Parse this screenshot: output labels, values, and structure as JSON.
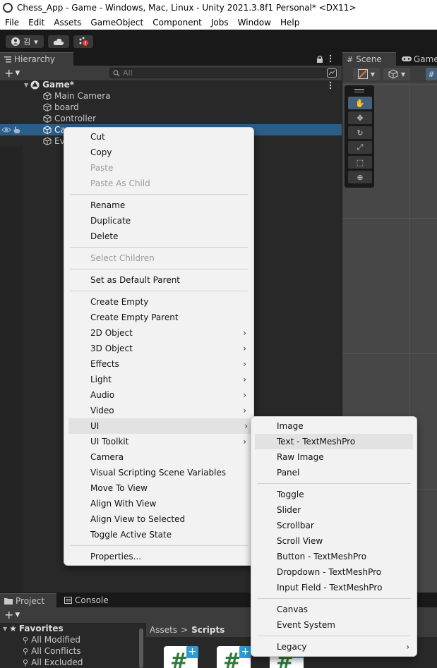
{
  "window": {
    "title": "Chess_App - Game - Windows, Mac, Linux - Unity 2021.3.8f1 Personal* <DX11>"
  },
  "menubar": [
    "File",
    "Edit",
    "Assets",
    "GameObject",
    "Component",
    "Jobs",
    "Window",
    "Help"
  ],
  "toolbar": {
    "account_label": "김",
    "account_caret": "▾"
  },
  "hierarchy": {
    "tab_label": "Hierarchy",
    "search_placeholder": "All",
    "scene_name": "Game*",
    "items": [
      "Main Camera",
      "board",
      "Controller",
      "Ca",
      "Ev"
    ]
  },
  "scene_panel": {
    "scene_tab": "Scene",
    "game_tab": "Game"
  },
  "context_menu": {
    "items": [
      {
        "label": "Cut",
        "enabled": true
      },
      {
        "label": "Copy",
        "enabled": true
      },
      {
        "label": "Paste",
        "enabled": false
      },
      {
        "label": "Paste As Child",
        "enabled": false
      },
      {
        "label": "Rename",
        "enabled": true
      },
      {
        "label": "Duplicate",
        "enabled": true
      },
      {
        "label": "Delete",
        "enabled": true
      },
      {
        "label": "Select Children",
        "enabled": false
      },
      {
        "label": "Set as Default Parent",
        "enabled": true
      },
      {
        "label": "Create Empty",
        "enabled": true
      },
      {
        "label": "Create Empty Parent",
        "enabled": true
      },
      {
        "label": "2D Object",
        "enabled": true,
        "submenu": true
      },
      {
        "label": "3D Object",
        "enabled": true,
        "submenu": true
      },
      {
        "label": "Effects",
        "enabled": true,
        "submenu": true
      },
      {
        "label": "Light",
        "enabled": true,
        "submenu": true
      },
      {
        "label": "Audio",
        "enabled": true,
        "submenu": true
      },
      {
        "label": "Video",
        "enabled": true,
        "submenu": true
      },
      {
        "label": "UI",
        "enabled": true,
        "submenu": true,
        "highlighted": true
      },
      {
        "label": "UI Toolkit",
        "enabled": true,
        "submenu": true
      },
      {
        "label": "Camera",
        "enabled": true
      },
      {
        "label": "Visual Scripting Scene Variables",
        "enabled": true
      },
      {
        "label": "Move To View",
        "enabled": true
      },
      {
        "label": "Align With View",
        "enabled": true
      },
      {
        "label": "Align View to Selected",
        "enabled": true
      },
      {
        "label": "Toggle Active State",
        "enabled": true
      },
      {
        "label": "Properties...",
        "enabled": true
      }
    ]
  },
  "ui_submenu": {
    "items": [
      {
        "label": "Image"
      },
      {
        "label": "Text - TextMeshPro",
        "highlighted": true
      },
      {
        "label": "Raw Image"
      },
      {
        "label": "Panel"
      },
      {
        "label": "Toggle"
      },
      {
        "label": "Slider"
      },
      {
        "label": "Scrollbar"
      },
      {
        "label": "Scroll View"
      },
      {
        "label": "Button - TextMeshPro"
      },
      {
        "label": "Dropdown - TextMeshPro"
      },
      {
        "label": "Input Field - TextMeshPro"
      },
      {
        "label": "Canvas"
      },
      {
        "label": "Event System"
      },
      {
        "label": "Legacy",
        "submenu": true
      }
    ]
  },
  "bottom": {
    "project_tab": "Project",
    "console_tab": "Console",
    "favorites_label": "Favorites",
    "favorites": [
      "All Modified",
      "All Conflicts",
      "All Excluded"
    ],
    "breadcrumb": {
      "root": "Assets",
      "sep": ">",
      "current": "Scripts"
    }
  },
  "colors": {
    "selection": "#2c5d87",
    "menu_bg": "#f2f2f2",
    "menu_highlight": "#e2e2e2",
    "panel_bg": "#282828",
    "scene_bg": "#474747"
  }
}
